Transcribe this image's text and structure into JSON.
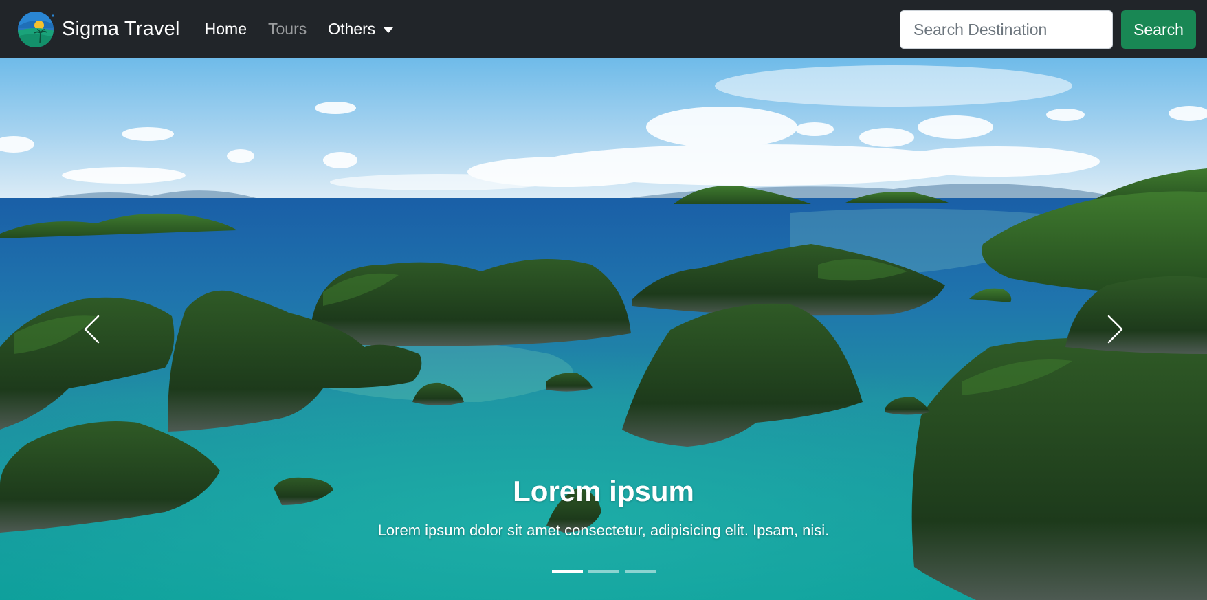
{
  "navbar": {
    "brand": {
      "name": "Sigma Travel",
      "logo_icon": "island-sunset-logo-icon"
    },
    "links": [
      {
        "label": "Home",
        "state": "normal"
      },
      {
        "label": "Tours",
        "state": "muted"
      }
    ],
    "dropdown": {
      "label": "Others",
      "icon": "caret-down-icon"
    },
    "search": {
      "placeholder": "Search Destination",
      "value": "",
      "button_label": "Search"
    }
  },
  "carousel": {
    "slides": [
      {
        "title": "Lorem ipsum",
        "text": "Lorem ipsum dolor sit amet consectetur, adipisicing elit. Ipsam, nisi.",
        "image": "tropical islands seascape"
      }
    ],
    "indicator_count": 3,
    "active_index": 0,
    "prev_icon": "chevron-left-icon",
    "next_icon": "chevron-right-icon"
  },
  "colors": {
    "navbar_bg": "#212529",
    "search_button": "#198754",
    "text_light": "#ffffff"
  }
}
